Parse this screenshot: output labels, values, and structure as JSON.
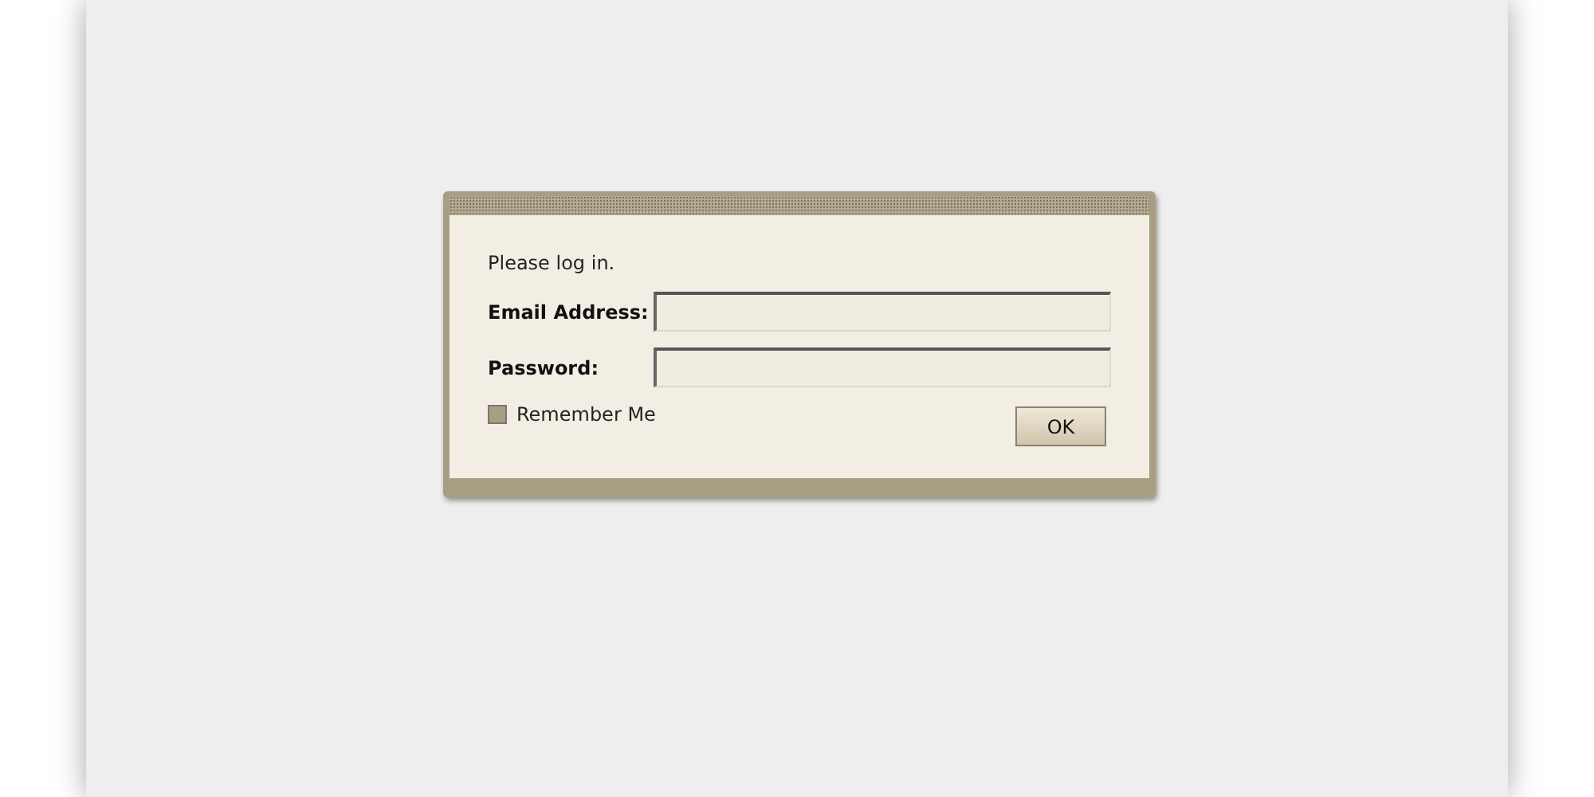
{
  "dialog": {
    "message": "Please log in.",
    "fields": [
      {
        "label": "Email Address:"
      },
      {
        "label": "Password:"
      }
    ],
    "remember": {
      "label": "Remember Me",
      "checked": false
    },
    "buttons": [
      "OK"
    ]
  }
}
